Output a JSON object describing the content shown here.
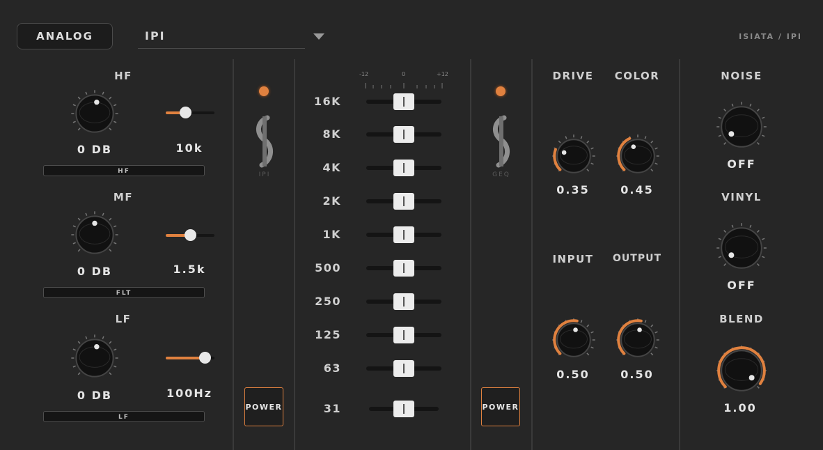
{
  "header": {
    "mode_button": "ANALOG",
    "preset": "IPI",
    "brand": "ISIATA / IPI"
  },
  "eq_bands": [
    {
      "label": "HF",
      "gain": "0 DB",
      "freq": "10k",
      "button": "HF",
      "slider_pos": 0.4
    },
    {
      "label": "MF",
      "gain": "0 DB",
      "freq": "1.5k",
      "button": "FLT",
      "slider_pos": 0.5
    },
    {
      "label": "LF",
      "gain": "0 DB",
      "freq": "100Hz",
      "button": "LF",
      "slider_pos": 0.8
    }
  ],
  "module_left": {
    "logo_label": "IPI",
    "power": "POWER"
  },
  "module_right": {
    "logo_label": "GEQ",
    "power": "POWER"
  },
  "geq": {
    "scale": [
      "-12",
      "0",
      "+12"
    ],
    "bands": [
      {
        "freq": "16K",
        "gain_db": 0
      },
      {
        "freq": "8K",
        "gain_db": 0
      },
      {
        "freq": "4K",
        "gain_db": 0
      },
      {
        "freq": "2K",
        "gain_db": 0
      },
      {
        "freq": "1K",
        "gain_db": 0
      },
      {
        "freq": "500",
        "gain_db": 0
      },
      {
        "freq": "250",
        "gain_db": 0
      },
      {
        "freq": "125",
        "gain_db": 0
      },
      {
        "freq": "63",
        "gain_db": 0
      },
      {
        "freq": "31",
        "gain_db": 0
      }
    ]
  },
  "saturation": {
    "drive": {
      "label": "DRIVE",
      "value": "0.35"
    },
    "color": {
      "label": "COLOR",
      "value": "0.45"
    },
    "input": {
      "label": "INPUT",
      "value": "0.50"
    },
    "output": {
      "label": "OUTPUT",
      "value": "0.50"
    }
  },
  "character": {
    "noise": {
      "label": "NOISE",
      "value": "OFF"
    },
    "vinyl": {
      "label": "VINYL",
      "value": "OFF"
    },
    "blend": {
      "label": "BLEND",
      "value": "1.00"
    }
  },
  "colors": {
    "accent": "#e0813f",
    "background": "#262626"
  }
}
